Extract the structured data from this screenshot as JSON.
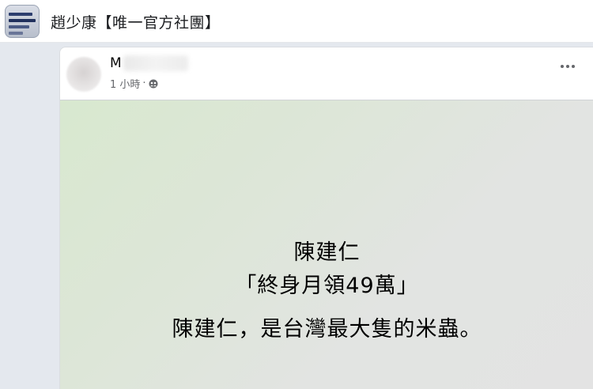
{
  "group": {
    "name": "趙少康【唯一官方社團】"
  },
  "post": {
    "author": "M",
    "time": "1 小時",
    "separator": "·",
    "privacy_icon": "group-members-icon",
    "more_icon": "more-options-icon",
    "image_text": {
      "line1": "陳建仁",
      "line2": "「終身月領49萬」",
      "line3": "陳建仁，是台灣最大隻的米蟲。"
    }
  },
  "colors": {
    "background": "#e4e8ee",
    "card": "#ffffff",
    "meta_text": "#65676b",
    "image_green": "#d8e8cf",
    "image_gray": "#e3e3e3"
  }
}
